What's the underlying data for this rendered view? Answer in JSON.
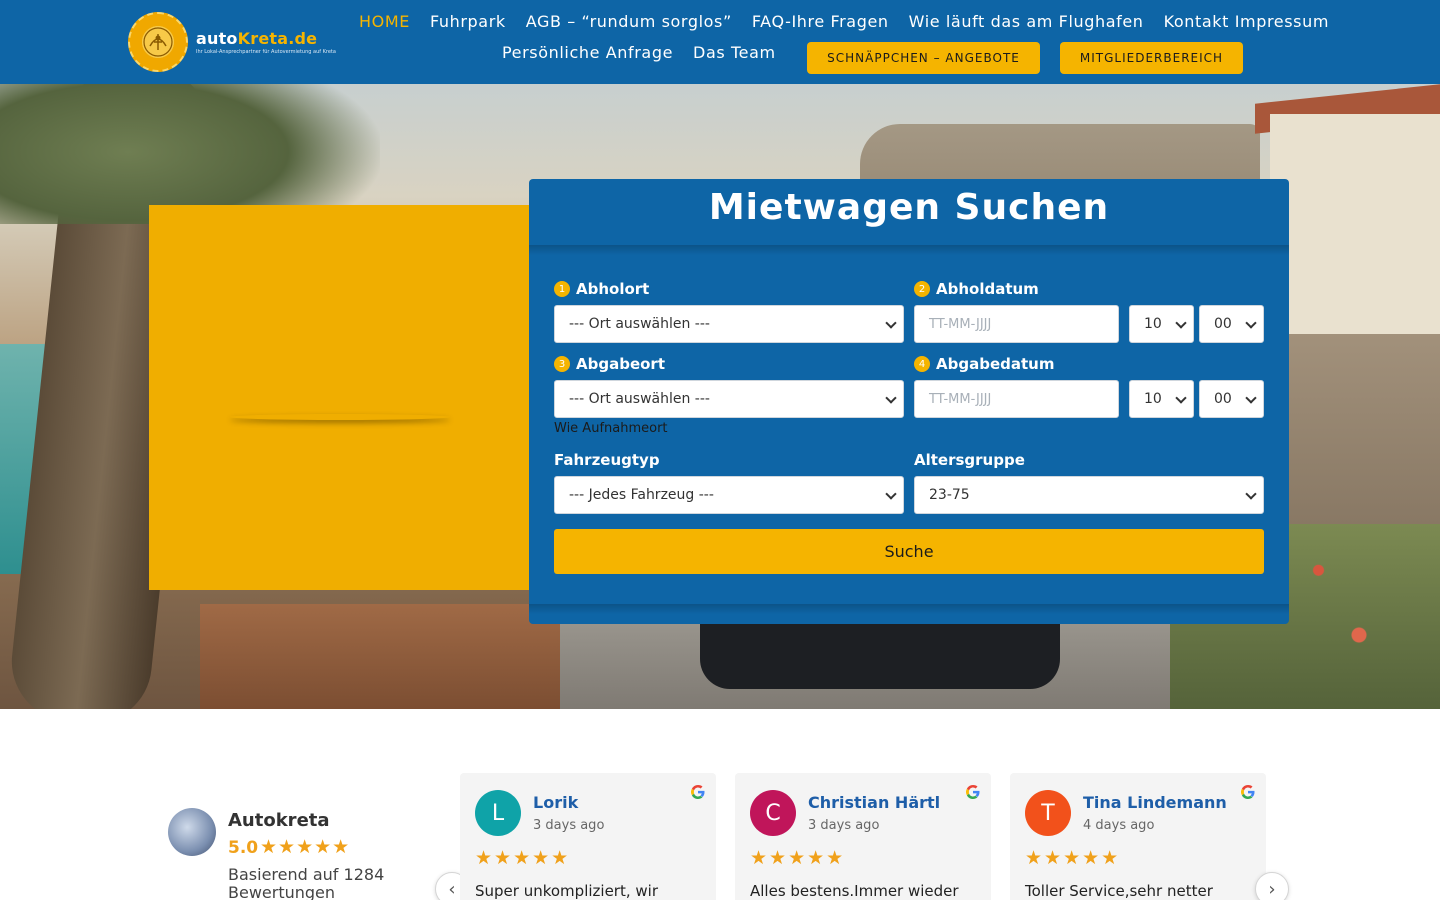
{
  "brand": {
    "name_part1": "auto",
    "name_part2": "Kreta.de",
    "tagline": "Ihr Lokal-Ansprechpartner für Autovermietung auf Kreta"
  },
  "nav": {
    "row1": [
      "HOME",
      "Fuhrpark",
      "AGB – “rundum sorglos”",
      "FAQ-Ihre Fragen",
      "Wie läuft das am Flughafen",
      "Kontakt Impressum"
    ],
    "row2": [
      "Persönliche Anfrage",
      "Das Team"
    ],
    "button_deals": "SCHNÄPPCHEN – ANGEBOTE",
    "button_members": "MITGLIEDERBEREICH",
    "active_item": "HOME"
  },
  "search": {
    "title": "Mietwagen Suchen",
    "pickup_location": {
      "step": "1",
      "label": "Abholort",
      "value": "--- Ort auswählen ---"
    },
    "pickup_date": {
      "step": "2",
      "label": "Abholdatum",
      "placeholder": "TT-MM-JJJJ",
      "hour": "10",
      "minute": "00"
    },
    "dropoff_location": {
      "step": "3",
      "label": "Abgabeort",
      "value": "--- Ort auswählen ---"
    },
    "dropoff_date": {
      "step": "4",
      "label": "Abgabedatum",
      "placeholder": "TT-MM-JJJJ",
      "hour": "10",
      "minute": "00"
    },
    "same_as_pickup_link": "Wie Aufnahmeort",
    "vehicle_type": {
      "label": "Fahrzeugtyp",
      "value": "--- Jedes Fahrzeug ---"
    },
    "age_group": {
      "label": "Altersgruppe",
      "value": "23-75"
    },
    "submit_label": "Suche"
  },
  "reviews_summary": {
    "name": "Autokreta",
    "score": "5.0",
    "stars": "★★★★★",
    "based_on": "Basierend auf 1284 Bewertungen"
  },
  "reviews": [
    {
      "initial": "L",
      "name": "Lorik",
      "date": "3 days ago",
      "stars": "★★★★★",
      "text": "Super unkompliziert, wir",
      "avatar_color": "#0fa3a8"
    },
    {
      "initial": "C",
      "name": "Christian Härtl",
      "date": "3 days ago",
      "stars": "★★★★★",
      "text": "Alles bestens.Immer wieder",
      "avatar_color": "#c0155a"
    },
    {
      "initial": "T",
      "name": "Tina Lindemann",
      "date": "4 days ago",
      "stars": "★★★★★",
      "text": "Toller Service,sehr netter",
      "avatar_color": "#f2511b"
    }
  ],
  "carousel": {
    "prev_icon": "‹",
    "next_icon": "›"
  },
  "colors": {
    "header_blue": "#0e65a6",
    "accent_yellow": "#f5b400",
    "star_orange": "#f0a11b",
    "review_name_blue": "#1e5ea8"
  }
}
